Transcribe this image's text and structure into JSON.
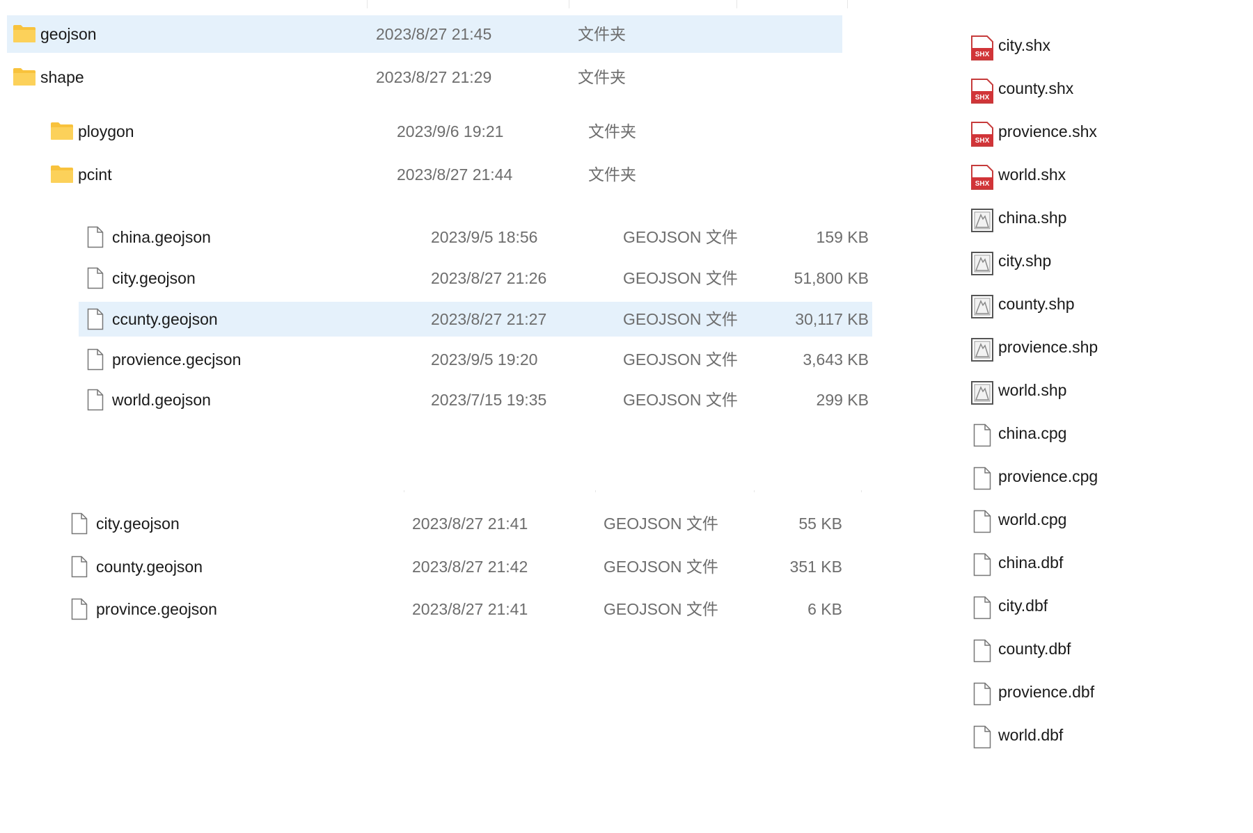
{
  "group_geojson": {
    "rows": [
      {
        "name": "geojson",
        "date": "2023/8/27 21:45",
        "type": "文件夹",
        "selected": true
      },
      {
        "name": "shape",
        "date": "2023/8/27 21:29",
        "type": "文件夹",
        "selected": false
      }
    ]
  },
  "group_subfolders": {
    "rows": [
      {
        "name": "ploygon",
        "date": "2023/9/6 19:21",
        "type": "文件夹"
      },
      {
        "name": "pcint",
        "date": "2023/8/27 21:44",
        "type": "文件夹"
      }
    ]
  },
  "group_files1": {
    "rows": [
      {
        "name": "china.geojson",
        "date": "2023/9/5 18:56",
        "type": "GEOJSON 文件",
        "size": "159 KB",
        "selected": false
      },
      {
        "name": "city.geojson",
        "date": "2023/8/27 21:26",
        "type": "GEOJSON 文件",
        "size": "51,800 KB",
        "selected": false
      },
      {
        "name": "ccunty.geojson",
        "date": "2023/8/27 21:27",
        "type": "GEOJSON 文件",
        "size": "30,117 KB",
        "selected": true
      },
      {
        "name": "provience.gecjson",
        "date": "2023/9/5 19:20",
        "type": "GEOJSON 文件",
        "size": "3,643 KB",
        "selected": false
      },
      {
        "name": "world.geojson",
        "date": "2023/7/15 19:35",
        "type": "GEOJSON 文件",
        "size": "299 KB",
        "selected": false
      }
    ]
  },
  "group_files2": {
    "rows": [
      {
        "name": "city.geojson",
        "date": "2023/8/27 21:41",
        "type": "GEOJSON 文件",
        "size": "55 KB"
      },
      {
        "name": "county.geojson",
        "date": "2023/8/27 21:42",
        "type": "GEOJSON 文件",
        "size": "351 KB"
      },
      {
        "name": "province.geojson",
        "date": "2023/8/27 21:41",
        "type": "GEOJSON 文件",
        "size": "6 KB"
      }
    ]
  },
  "right_list": {
    "items": [
      {
        "name": "city.shx",
        "icon": "shx-file-icon"
      },
      {
        "name": "county.shx",
        "icon": "shx-file-icon"
      },
      {
        "name": "provience.shx",
        "icon": "shx-file-icon"
      },
      {
        "name": "world.shx",
        "icon": "shx-file-icon"
      },
      {
        "name": "china.shp",
        "icon": "shp-file-icon"
      },
      {
        "name": "city.shp",
        "icon": "shp-file-icon"
      },
      {
        "name": "county.shp",
        "icon": "shp-file-icon"
      },
      {
        "name": "provience.shp",
        "icon": "shp-file-icon"
      },
      {
        "name": "world.shp",
        "icon": "shp-file-icon"
      },
      {
        "name": "china.cpg",
        "icon": "file-icon"
      },
      {
        "name": "provience.cpg",
        "icon": "file-icon"
      },
      {
        "name": "world.cpg",
        "icon": "file-icon"
      },
      {
        "name": "china.dbf",
        "icon": "file-icon"
      },
      {
        "name": "city.dbf",
        "icon": "file-icon"
      },
      {
        "name": "county.dbf",
        "icon": "file-icon"
      },
      {
        "name": "provience.dbf",
        "icon": "file-icon"
      },
      {
        "name": "world.dbf",
        "icon": "file-icon"
      }
    ]
  },
  "icon_labels": {
    "shx": "SHX"
  },
  "colors": {
    "selection": "#e5f1fb",
    "folder": "#f8c23c",
    "shx_red": "#d13438",
    "meta_text": "#6d6d6d"
  }
}
